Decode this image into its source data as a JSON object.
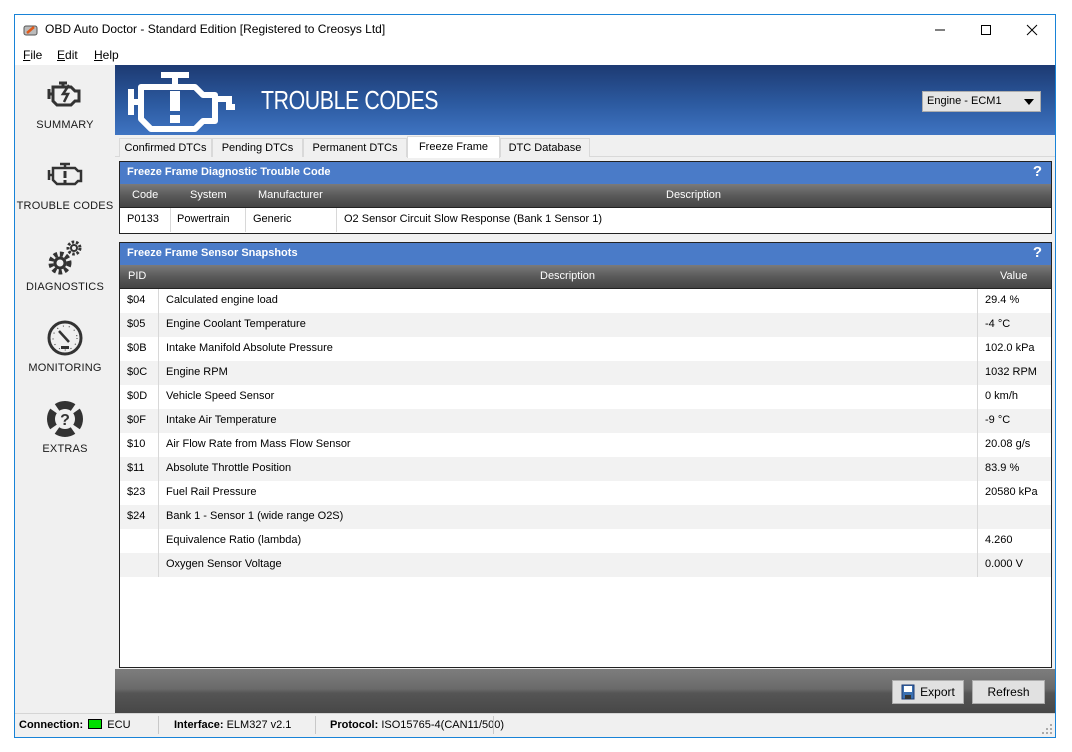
{
  "window": {
    "title": "OBD Auto Doctor - Standard Edition [Registered to Creosys Ltd]",
    "controls": {
      "minimize": "minimize-icon",
      "maximize": "maximize-icon",
      "close": "close-icon"
    }
  },
  "menu": {
    "items": [
      {
        "label": "File",
        "mnemonic": "F",
        "rest": "ile"
      },
      {
        "label": "Edit",
        "mnemonic": "E",
        "rest": "dit"
      },
      {
        "label": "Help",
        "mnemonic": "H",
        "rest": "elp"
      }
    ]
  },
  "sidebar": {
    "items": [
      {
        "label": "SUMMARY",
        "icon": "engine-flash-icon"
      },
      {
        "label": "TROUBLE CODES",
        "icon": "engine-warning-icon"
      },
      {
        "label": "DIAGNOSTICS",
        "icon": "gears-icon"
      },
      {
        "label": "MONITORING",
        "icon": "gauge-icon"
      },
      {
        "label": "EXTRAS",
        "icon": "help-lifebuoy-icon"
      }
    ]
  },
  "banner": {
    "title": "TROUBLE CODES",
    "ecu_select": {
      "selected": "Engine - ECM1"
    }
  },
  "tabs": [
    {
      "label": "Confirmed DTCs",
      "active": false
    },
    {
      "label": "Pending DTCs",
      "active": false
    },
    {
      "label": "Permanent DTCs",
      "active": false
    },
    {
      "label": "Freeze Frame",
      "active": true
    },
    {
      "label": "DTC Database",
      "active": false
    }
  ],
  "dtc_panel": {
    "title": "Freeze Frame Diagnostic Trouble Code",
    "help": "?",
    "columns": [
      "Code",
      "System",
      "Manufacturer",
      "Description"
    ],
    "rows": [
      {
        "code": "P0133",
        "system": "Powertrain",
        "manufacturer": "Generic",
        "description": "O2 Sensor Circuit Slow Response (Bank 1 Sensor 1)"
      }
    ]
  },
  "snapshot_panel": {
    "title": "Freeze Frame Sensor Snapshots",
    "help": "?",
    "columns": [
      "PID",
      "Description",
      "Value"
    ],
    "rows": [
      {
        "pid": "$04",
        "description": "Calculated engine load",
        "value": "29.4 %"
      },
      {
        "pid": "$05",
        "description": "Engine Coolant Temperature",
        "value": "-4 °C"
      },
      {
        "pid": "$0B",
        "description": "Intake Manifold Absolute Pressure",
        "value": "102.0 kPa"
      },
      {
        "pid": "$0C",
        "description": "Engine RPM",
        "value": "1032 RPM"
      },
      {
        "pid": "$0D",
        "description": "Vehicle Speed Sensor",
        "value": "0 km/h"
      },
      {
        "pid": "$0F",
        "description": "Intake Air Temperature",
        "value": "-9 °C"
      },
      {
        "pid": "$10",
        "description": "Air Flow Rate from Mass Flow Sensor",
        "value": "20.08 g/s"
      },
      {
        "pid": "$11",
        "description": "Absolute Throttle Position",
        "value": "83.9 %"
      },
      {
        "pid": "$23",
        "description": "Fuel Rail Pressure",
        "value": "20580 kPa"
      },
      {
        "pid": "$24",
        "description": "Bank 1 - Sensor 1 (wide range O2S)",
        "value": ""
      },
      {
        "pid": "",
        "description": "Equivalence Ratio (lambda)",
        "value": "4.260"
      },
      {
        "pid": "",
        "description": "Oxygen Sensor Voltage",
        "value": "0.000 V"
      }
    ]
  },
  "actions": {
    "export_label": "Export",
    "refresh_label": "Refresh"
  },
  "statusbar": {
    "connection_label": "Connection:",
    "connection_value": "ECU",
    "connection_color": "#00e000",
    "interface_label": "Interface:",
    "interface_value": "ELM327 v2.1",
    "protocol_label": "Protocol:",
    "protocol_value": "ISO15765-4(CAN11/500)"
  },
  "colors": {
    "accent": "#4a7bc8",
    "banner": "#2c5aa0",
    "window_border": "#1883d7"
  }
}
